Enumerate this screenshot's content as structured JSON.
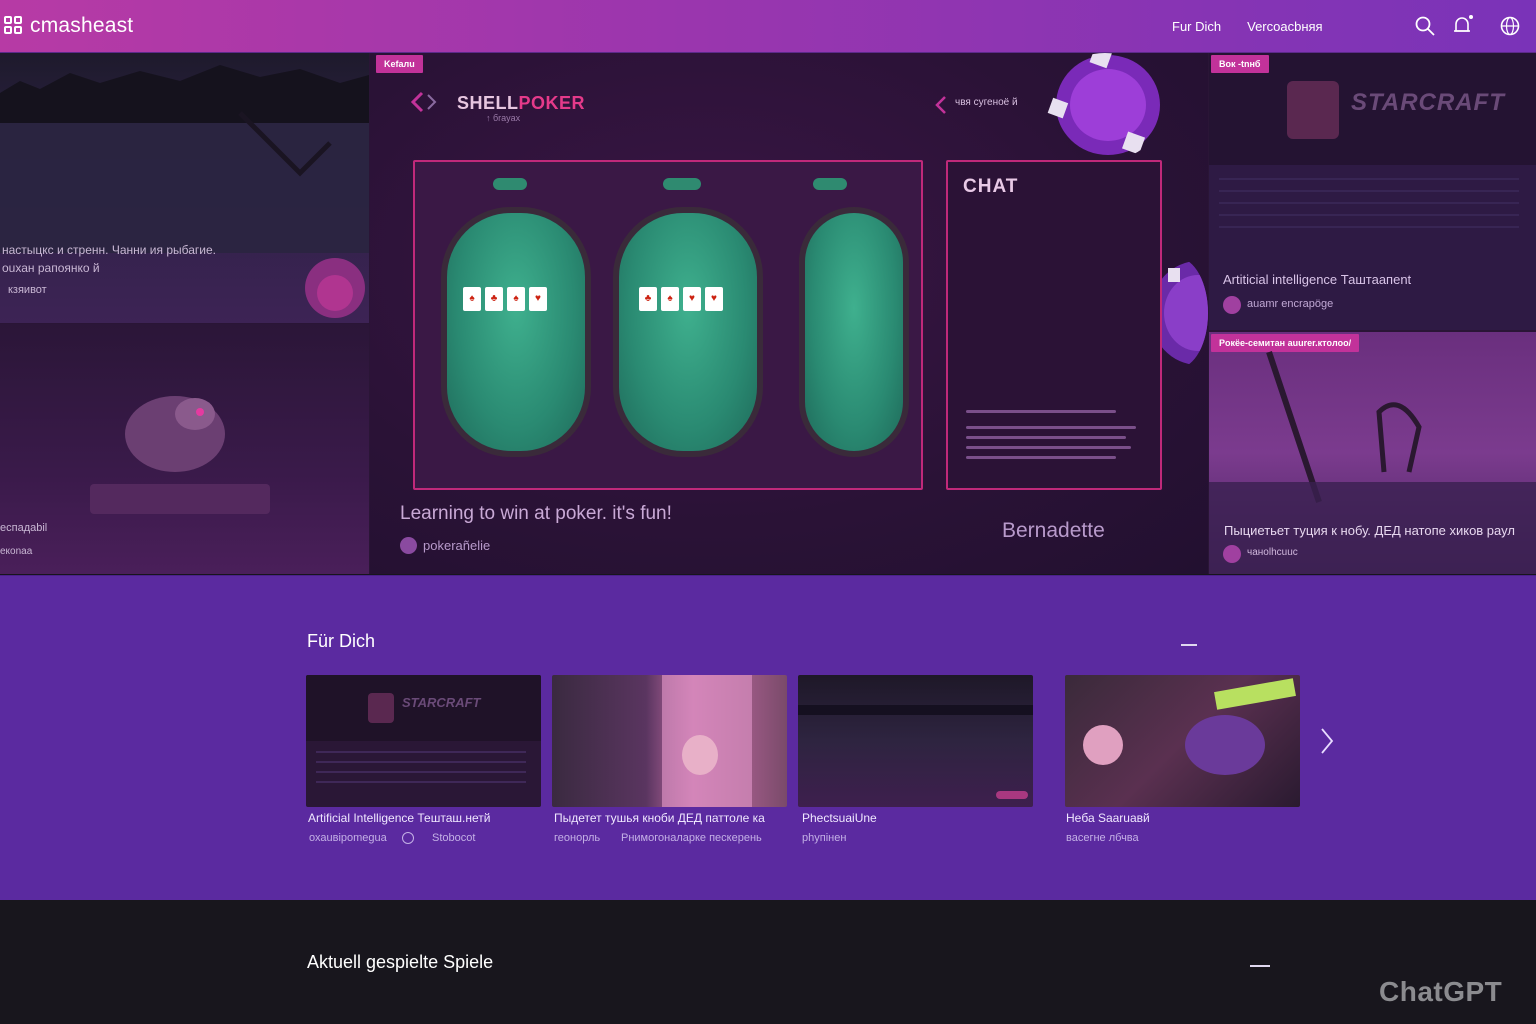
{
  "header": {
    "logo_text": "cmasheast",
    "nav": [
      {
        "label": "Fur Dich"
      },
      {
        "label": "Vercoacbняя"
      }
    ]
  },
  "hero": {
    "left_top": {
      "text_line1": "настыцкс и стренн. Чанни ия рыбагие.",
      "text_line2": "оuхан рапоянко й",
      "user": "кзяивот"
    },
    "left_bottom": {
      "text_line1": "еспадаbil",
      "text_line2": "екоnаа"
    },
    "center": {
      "badge": "Kefaлu",
      "game_title_a": "SHELL",
      "game_title_b": "POKER",
      "game_sub": "↑ бrayaх",
      "back_link": "чвя сугеноё й",
      "chat_title": "CHAT",
      "caption": "Learning to win at poker. it's fun!",
      "streamer": "pokerañelie",
      "right_name": "Bernadette"
    },
    "right_top": {
      "badge": "Вок -tnнб",
      "logo": "STARCRAFT",
      "title": "Artiticial intelligence Таштаапеnt",
      "user": "auamr encrapöge"
    },
    "right_bottom": {
      "badge": "Poкёe-ceмитан auurer.ктoлоо/",
      "title": "Пыциетьет туция к нобу. ДЕД натопе хиков раул",
      "user": "чаноlhcuuc"
    }
  },
  "fuer_dich": {
    "title": "Für Dich",
    "items": [
      {
        "title": "Artificial Intelligence Тешташ.нетй",
        "sub_a": "охаuвіроmеguа",
        "sub_b": "Stobocot"
      },
      {
        "title": "Пыдетет тушья кноби ДЕД паттоле ка",
        "sub_a": "геонорль",
        "sub_b": "Рнимогоналарке пескерень"
      },
      {
        "title": "PhectsuaiUne",
        "sub_a": "phyпiнен",
        "sub_b": ""
      },
      {
        "title": "Heба Saaruавй",
        "sub_a": "васегне лбчва",
        "sub_b": ""
      }
    ],
    "thumb_logo": "STARCRAFT"
  },
  "aktuell": {
    "title": "Aktuell gespielte Spiele"
  },
  "watermark": "ChatGPT",
  "colors": {
    "accent": "#c2329a",
    "section_bg": "#5b2aa0",
    "header_from": "#b73aa5",
    "header_to": "#7a33b8"
  },
  "icons": [
    "logo-icon",
    "search-icon",
    "bell-icon",
    "globe-icon",
    "chevron-left-icon",
    "chevron-right-icon",
    "avatar-icon"
  ]
}
